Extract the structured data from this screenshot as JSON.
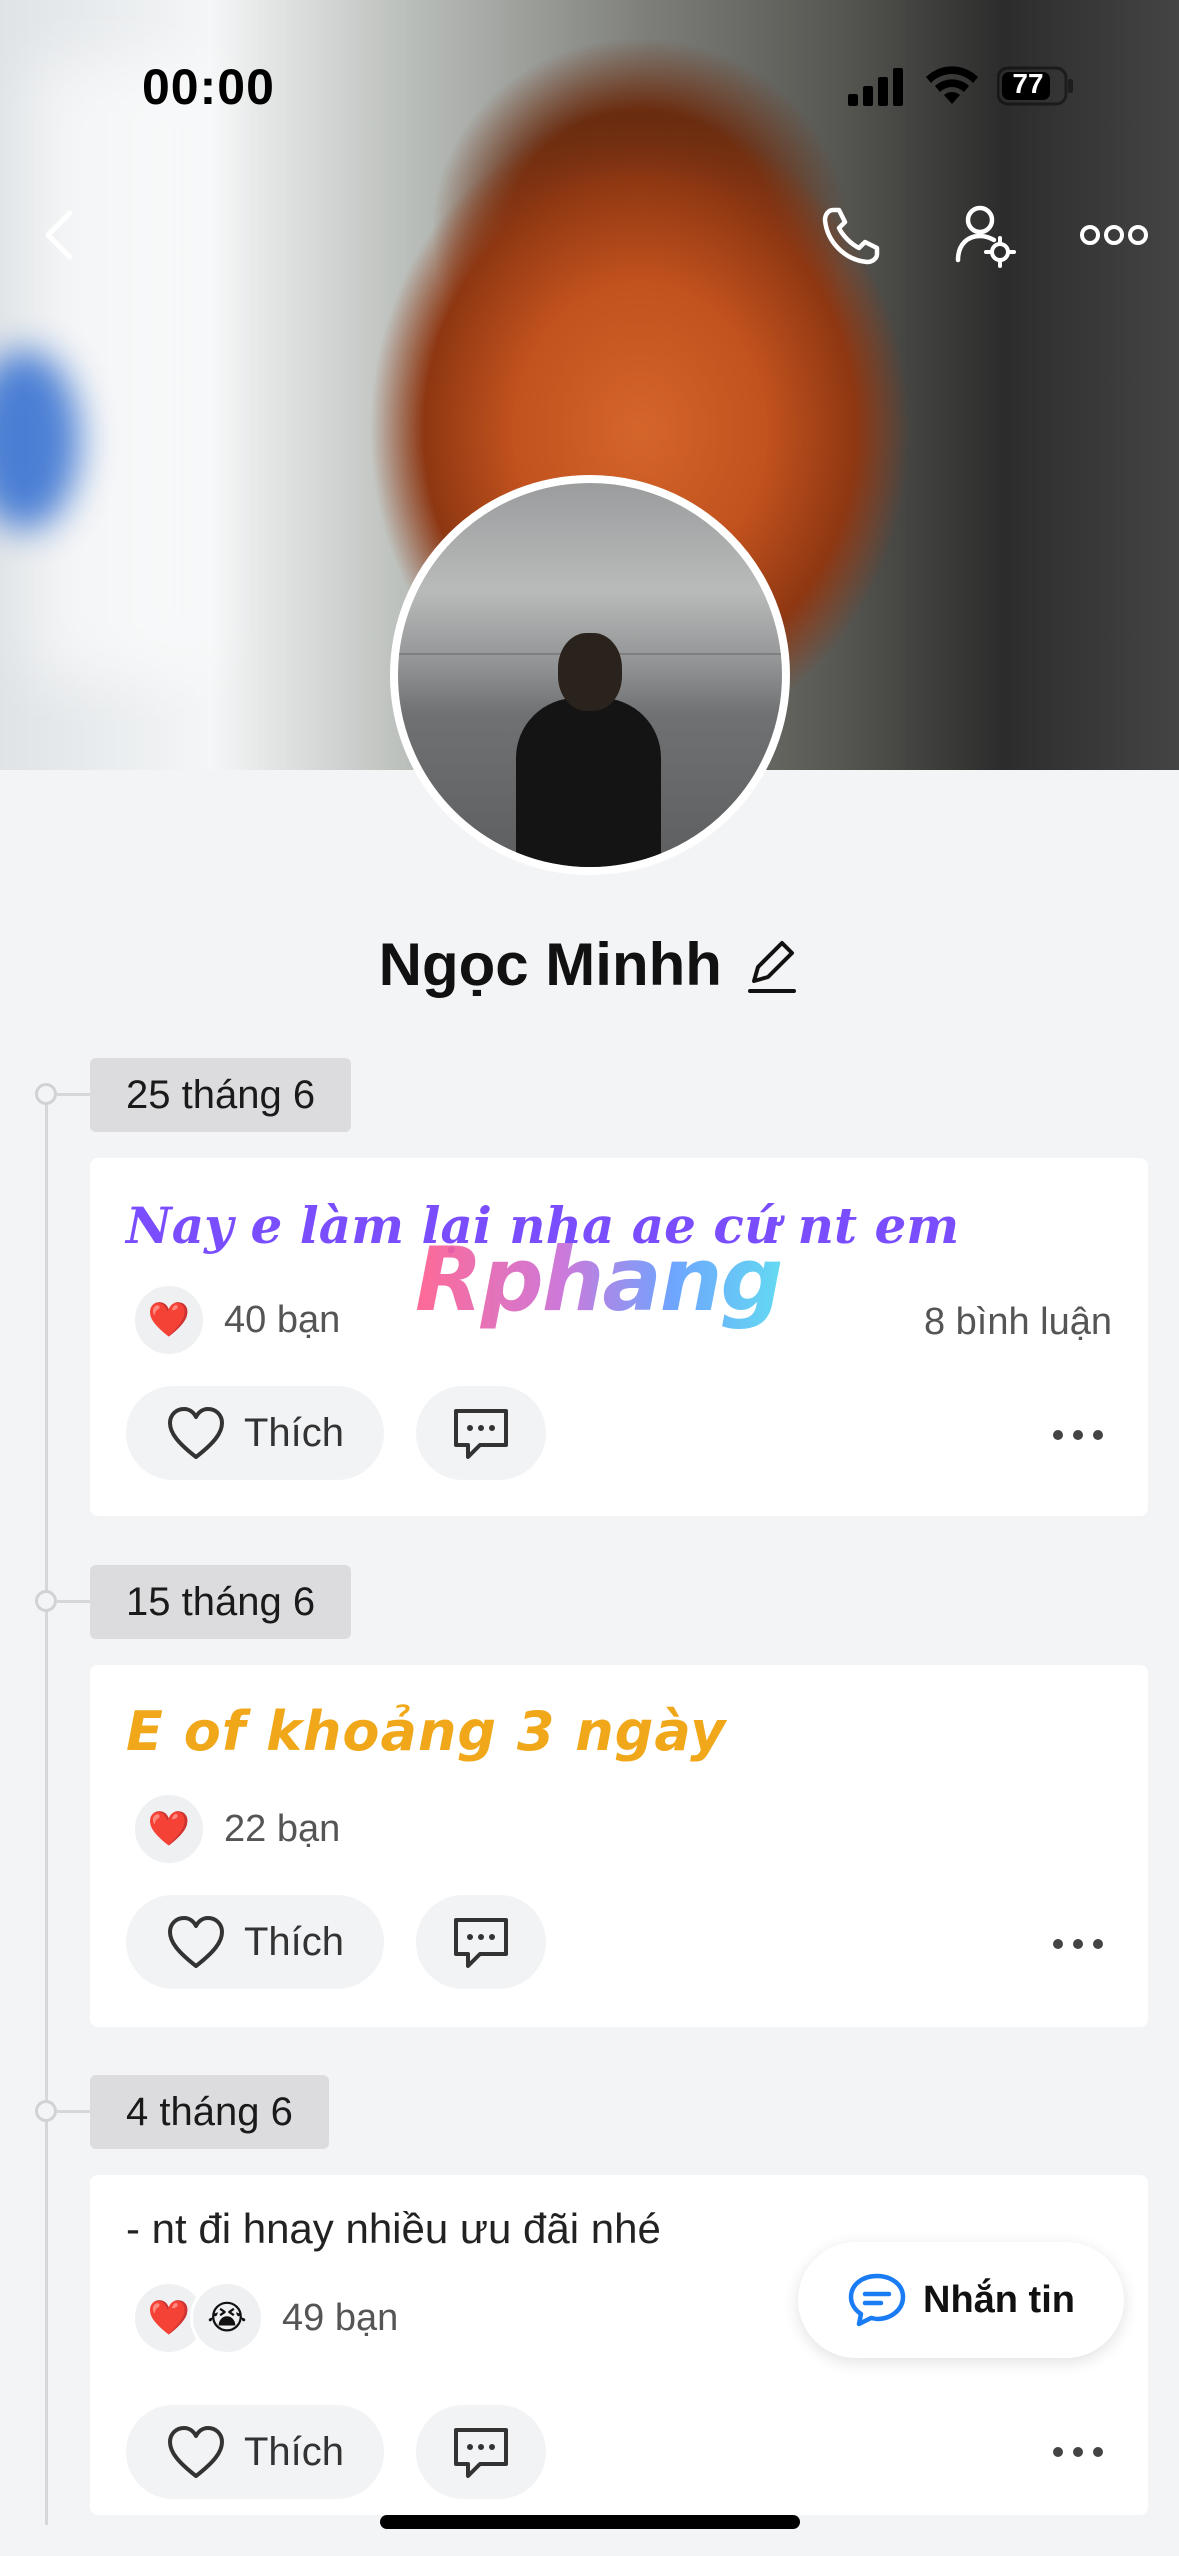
{
  "status_bar": {
    "time": "00:00",
    "battery": "77"
  },
  "profile": {
    "name": "Ngọc Minhh"
  },
  "posts": [
    {
      "date": "25 tháng 6",
      "text": "Nay e làm lại nha ae cứ nt em",
      "reactions": [
        "heart"
      ],
      "reaction_count": "40 bạn",
      "comments": "8 bình luận",
      "like_label": "Thích"
    },
    {
      "date": "15 tháng 6",
      "text": "E of khoảng 3 ngày",
      "reactions": [
        "heart"
      ],
      "reaction_count": "22 bạn",
      "comments": "",
      "like_label": "Thích"
    },
    {
      "date": "4 tháng 6",
      "text": "- nt đi hnay nhiều ưu đãi nhé",
      "reactions": [
        "heart",
        "crying-face"
      ],
      "reaction_count": "49 bạn",
      "comments": "",
      "like_label": "Thích"
    }
  ],
  "watermark": "Rphang",
  "message_button": {
    "label": "Nhắn tin"
  },
  "colors": {
    "post1_text": "#7a4dff",
    "post2_text": "#f0a81a",
    "accent_blue": "#1a7cf5"
  }
}
